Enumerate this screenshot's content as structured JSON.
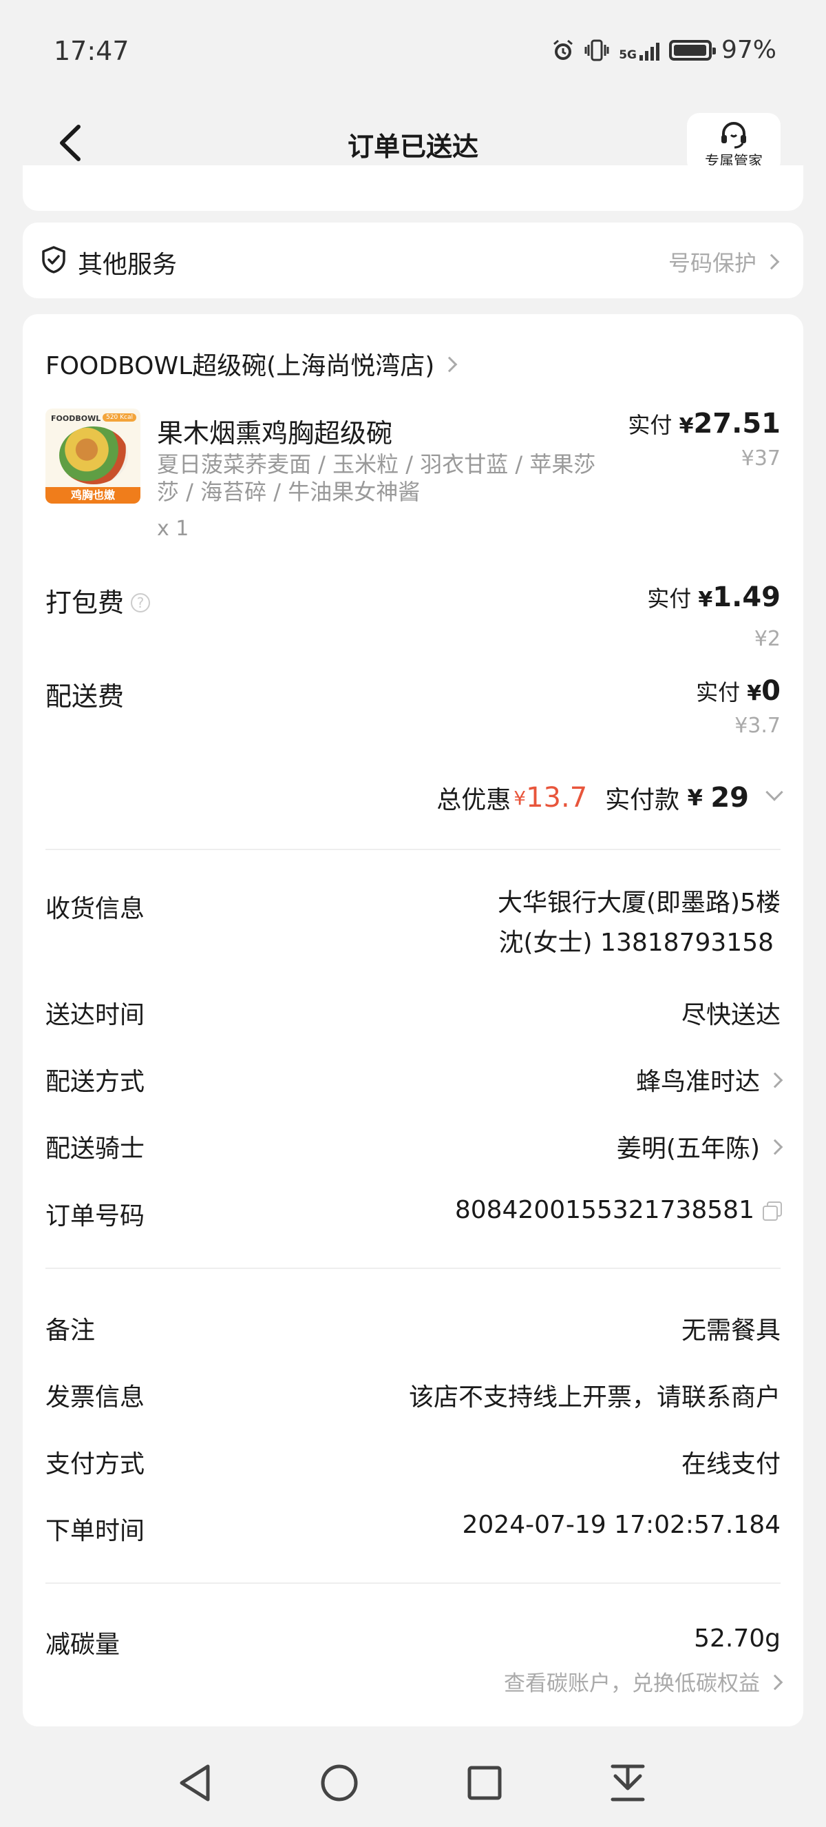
{
  "status_bar": {
    "time": "17:47",
    "network": "5G",
    "battery": "97%",
    "battery_level": 0.97
  },
  "header": {
    "title": "订单已送达",
    "steward_label": "专属管家"
  },
  "other_services": {
    "label": "其他服务",
    "value": "号码保护"
  },
  "store": {
    "name": "FOODBOWL超级碗(上海尚悦湾店)"
  },
  "item": {
    "name": "果木烟熏鸡胸超级碗",
    "specs": "夏日菠菜荞麦面 / 玉米粒 / 羽衣甘蓝 / 苹果莎莎 / 海苔碎 / 牛油果女神酱",
    "qty": "x 1",
    "paid_label": "实付",
    "paid_yen": "¥",
    "paid": "27.51",
    "original": "¥37",
    "thumb_brand": "FOODBOWL",
    "thumb_kcal": "520 Kcal",
    "thumb_tag": "鸡胸也嫩"
  },
  "packing_fee": {
    "label": "打包费",
    "paid_label": "实付",
    "paid_yen": "¥",
    "paid": "1.49",
    "original": "¥2"
  },
  "delivery_fee": {
    "label": "配送费",
    "paid_label": "实付",
    "paid_yen": "¥",
    "paid": "0",
    "original": "¥3.7"
  },
  "totals": {
    "discount_label": "总优惠",
    "discount_yen": "¥",
    "discount": "13.7",
    "paid_label": "实付款",
    "paid_yen": "¥",
    "paid": "29"
  },
  "delivery_info": [
    {
      "label": "收货信息",
      "value": "大华银行大厦(即墨路)5楼",
      "value2": "沈(女士) 13818793158"
    },
    {
      "label": "送达时间",
      "value": "尽快送达"
    },
    {
      "label": "配送方式",
      "value": "蜂鸟准时达"
    },
    {
      "label": "配送骑士",
      "value": "姜明(五年陈)"
    },
    {
      "label": "订单号码",
      "value": "8084200155321738581"
    }
  ],
  "order_info": [
    {
      "label": "备注",
      "value": "无需餐具"
    },
    {
      "label": "发票信息",
      "value": "该店不支持线上开票，请联系商户"
    },
    {
      "label": "支付方式",
      "value": "在线支付"
    },
    {
      "label": "下单时间",
      "value": "2024-07-19 17:02:57.184"
    }
  ],
  "carbon": {
    "label": "减碳量",
    "value": "52.70g",
    "link": "查看碳账户，兑换低碳权益"
  },
  "colors": {
    "accent_red": "#e8553b",
    "background": "#f2f2f2"
  }
}
